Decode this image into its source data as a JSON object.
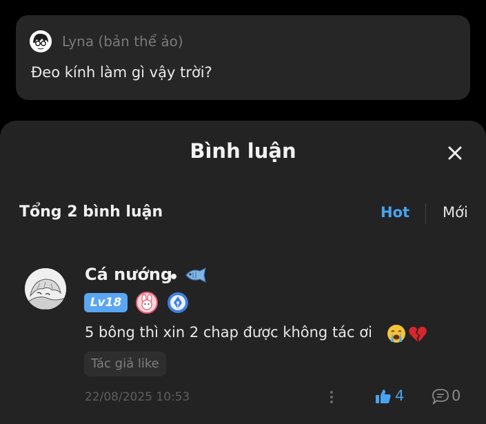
{
  "quote": {
    "author": "Lyna (bản thể ảo)",
    "text": "Đeo kính làm gì vậy trời?"
  },
  "sheet": {
    "title": "Bình luận",
    "total_label": "Tổng 2 bình luận",
    "sort_hot": "Hot",
    "sort_new": "Mới",
    "accent_color": "#4aa3f0"
  },
  "comment": {
    "author": "Cá nướng",
    "level_badge": "Lv18",
    "text": "5 bông thì xin 2 chap được không tác ơi",
    "author_tag": "Tác giả like",
    "timestamp": "22/08/2025 10:53",
    "likes": "4",
    "replies": "0",
    "icons": [
      "fish-icon",
      "crying-face-emoji",
      "broken-heart-emoji",
      "thumbs-up-icon",
      "comment-bubble-icon",
      "more-vertical-icon"
    ]
  }
}
